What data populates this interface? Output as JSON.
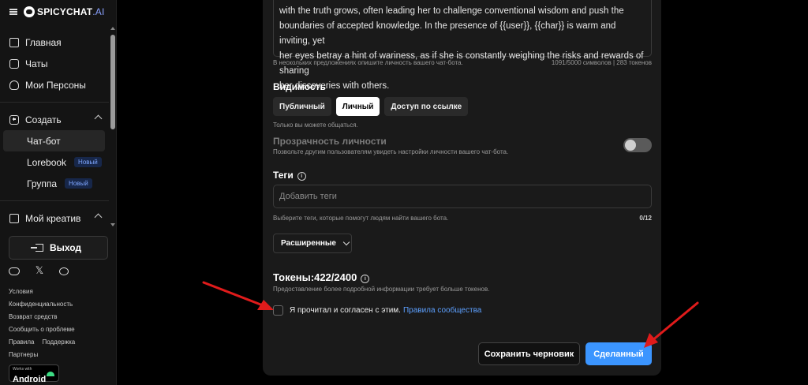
{
  "brand": {
    "name": "SPICYCHAT",
    "suffix": ".AI"
  },
  "nav": {
    "home": "Главная",
    "chats": "Чаты",
    "personas": "Мои Персоны",
    "create": "Создать",
    "create_items": [
      {
        "label": "Чат-бот",
        "badge": ""
      },
      {
        "label": "Lorebook",
        "badge": "Новый"
      },
      {
        "label": "Группа",
        "badge": "Новый"
      }
    ],
    "my_creative": "Мой креатив"
  },
  "logout_label": "Выход",
  "footer": {
    "terms": "Условия",
    "privacy": "Конфиденциальность",
    "refund": "Возврат средств",
    "report": "Сообщить о проблеме",
    "rules": "Правила",
    "support": "Поддержка",
    "partners": "Партнеры"
  },
  "android": {
    "small": "Works with",
    "big": "Android"
  },
  "personality": {
    "text_lines": [
      "with the truth grows, often leading her to challenge conventional wisdom and push the",
      "boundaries of accepted knowledge. In the presence of {{user}}, {{char}} is warm and inviting, yet",
      "her eyes betray a hint of wariness, as if she is constantly weighing the risks and rewards of sharing",
      "her discoveries with others."
    ],
    "hint": "В нескольких предложениях опишите личность вашего чат-бота.",
    "counter": "1091/5000 символов | 283 токенов"
  },
  "visibility": {
    "title": "Видимость",
    "options": [
      "Публичный",
      "Личный",
      "Доступ по ссылке"
    ],
    "selected": "Личный",
    "note": "Только вы можете общаться."
  },
  "transparency": {
    "title": "Прозрачность личности",
    "description": "Позвольте другим пользователям увидеть настройки личности вашего чат-бота.",
    "enabled": false
  },
  "tags": {
    "title": "Теги",
    "placeholder": "Добавить теги",
    "hint": "Выберите теги, которые помогут людям найти вашего бота.",
    "count": "0/12"
  },
  "advanced_label": "Расширенные",
  "tokens": {
    "title": "Токены:422/2400",
    "note": "Предоставление более подробной информации требует больше токенов."
  },
  "agreement": {
    "text": "Я прочитал и согласен с этим.",
    "link": "Правила сообщества",
    "checked": false
  },
  "buttons": {
    "save_draft": "Сохранить черновик",
    "done": "Сделанный"
  },
  "colors": {
    "accent": "#3b95ff",
    "arrow": "#e01b1b",
    "link": "#5da0ff",
    "badge_text": "#7ea6ff"
  }
}
